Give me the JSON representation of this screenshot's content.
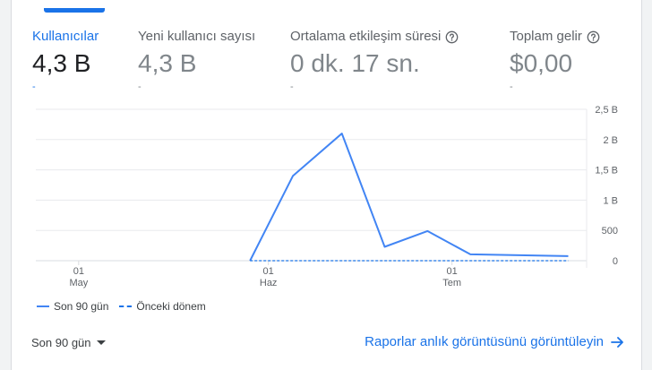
{
  "metrics": [
    {
      "label": "Kullanıcılar",
      "value": "4,3 B",
      "delta": "-",
      "active": true,
      "help": false
    },
    {
      "label": "Yeni kullanıcı sayısı",
      "value": "4,3 B",
      "delta": "-",
      "active": false,
      "help": false
    },
    {
      "label": "Ortalama etkileşim süresi",
      "value": "0 dk. 17 sn.",
      "delta": "-",
      "active": false,
      "help": true
    },
    {
      "label": "Toplam gelir",
      "value": "$0,00",
      "delta": "-",
      "active": false,
      "help": true
    }
  ],
  "legend": {
    "current": "Son 90 gün",
    "previous": "Önceki dönem"
  },
  "footer": {
    "range_label": "Son 90 gün",
    "report_link": "Raporlar anlık görüntüsünü görüntüleyin"
  },
  "colors": {
    "accent": "#1a73e8",
    "line": "#4285f4",
    "grid": "#e8eaed",
    "axis": "#dadce0"
  },
  "icons": {
    "help": "help-circle-icon",
    "dropdown": "caret-down-icon",
    "link": "arrow-right-icon"
  },
  "chart_data": {
    "type": "line",
    "ylim": [
      0,
      2500
    ],
    "y_ticks": [
      {
        "value": 0,
        "label": "0"
      },
      {
        "value": 500,
        "label": "500"
      },
      {
        "value": 1000,
        "label": "1 B"
      },
      {
        "value": 1500,
        "label": "1,5 B"
      },
      {
        "value": 2000,
        "label": "2 B"
      },
      {
        "value": 2500,
        "label": "2,5 B"
      }
    ],
    "x_ticks": [
      {
        "day": 0,
        "day_label": "01",
        "month_label": "May"
      },
      {
        "day": 31,
        "day_label": "01",
        "month_label": "Haz"
      },
      {
        "day": 61,
        "day_label": "01",
        "month_label": "Tem"
      }
    ],
    "x_range": [
      -7,
      83
    ],
    "series": [
      {
        "name": "Son 90 gün",
        "style": "solid",
        "points": [
          [
            28,
            0
          ],
          [
            35,
            1400
          ],
          [
            43,
            2100
          ],
          [
            50,
            230
          ],
          [
            57,
            490
          ],
          [
            64,
            105
          ],
          [
            80,
            75
          ]
        ]
      },
      {
        "name": "Önceki dönem",
        "style": "dashed",
        "points": [
          [
            28,
            0
          ],
          [
            80,
            0
          ]
        ]
      }
    ],
    "grid": true,
    "legend_position": "bottom-left"
  }
}
